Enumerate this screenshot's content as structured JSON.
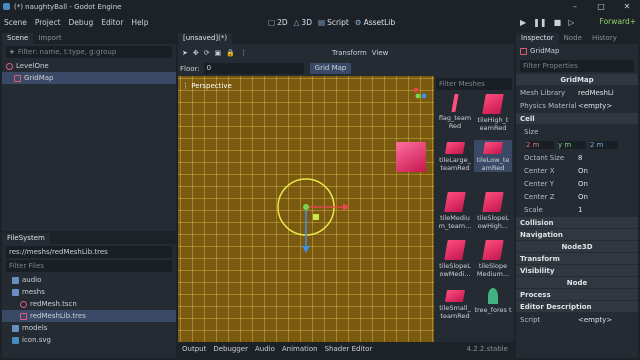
{
  "window": {
    "title": "(*) naughtyBall - Godot Engine"
  },
  "menu": [
    "Scene",
    "Project",
    "Debug",
    "Editor",
    "Help"
  ],
  "main_screens": {
    "d2": "2D",
    "d3": "3D",
    "script": "Script",
    "assetlib": "AssetLib"
  },
  "renderer": "Forward+",
  "scene_dock": {
    "tabs": [
      "Scene",
      "Import"
    ],
    "filter_placeholder": "Filter: name, t:type, g:group",
    "nodes": [
      "LevelOne",
      "GridMap"
    ]
  },
  "filesystem": {
    "tab": "FileSystem",
    "path": "res://meshs/redMeshLib.tres",
    "filter_placeholder": "Filter Files",
    "items": [
      "audio",
      "meshs",
      "redMesh.tscn",
      "redMeshLib.tres",
      "models",
      "icon.svg"
    ]
  },
  "editor_tab": "[unsaved](*)",
  "toolbar": {
    "transform": "Transform",
    "view": "View"
  },
  "floor": {
    "label": "Floor:",
    "value": "0"
  },
  "gridmap_button": "Grid Map",
  "viewport_label": "Perspective",
  "mesh_panel": {
    "filter_placeholder": "Filter Meshes",
    "items": [
      "flag_team Red",
      "tileHigh_t eamRed",
      "tileLarge_ teamRed",
      "tileLow_te amRed",
      "tileMediu m_team...",
      "tileSlopeL owHigh...",
      "tileSlopeL owMedi...",
      "tileSlope Medium...",
      "tileSmall_ teamRed",
      "tree_fores t"
    ]
  },
  "bottom_tabs": [
    "Output",
    "Debugger",
    "Audio",
    "Animation",
    "Shader Editor"
  ],
  "version": "4.2.2.stable",
  "inspector": {
    "tabs": [
      "Inspector",
      "Node",
      "History"
    ],
    "node_name": "GridMap",
    "filter_placeholder": "Filter Properties",
    "class": "GridMap",
    "mesh_library": {
      "label": "Mesh Library",
      "value": "redMeshLi"
    },
    "physics_material": {
      "label": "Physics Material",
      "value": "<empty>"
    },
    "sections": {
      "cell": "Cell",
      "collision": "Collision",
      "navigation": "Navigation",
      "node3d": "Node3D",
      "transform": "Transform",
      "visibility": "Visibility",
      "node": "Node",
      "process": "Process",
      "editor_desc": "Editor Description"
    },
    "cell": {
      "size_label": "Size",
      "size_x": "2 m",
      "size_y": "y  m",
      "size_z": "2 m",
      "octant_label": "Octant Size",
      "octant_value": "8",
      "center_x": "Center X",
      "center_y": "Center Y",
      "center_z": "Center Z",
      "on": "On",
      "scale_label": "Scale",
      "scale_value": "1"
    },
    "script": {
      "label": "Script",
      "value": "<empty>"
    }
  }
}
